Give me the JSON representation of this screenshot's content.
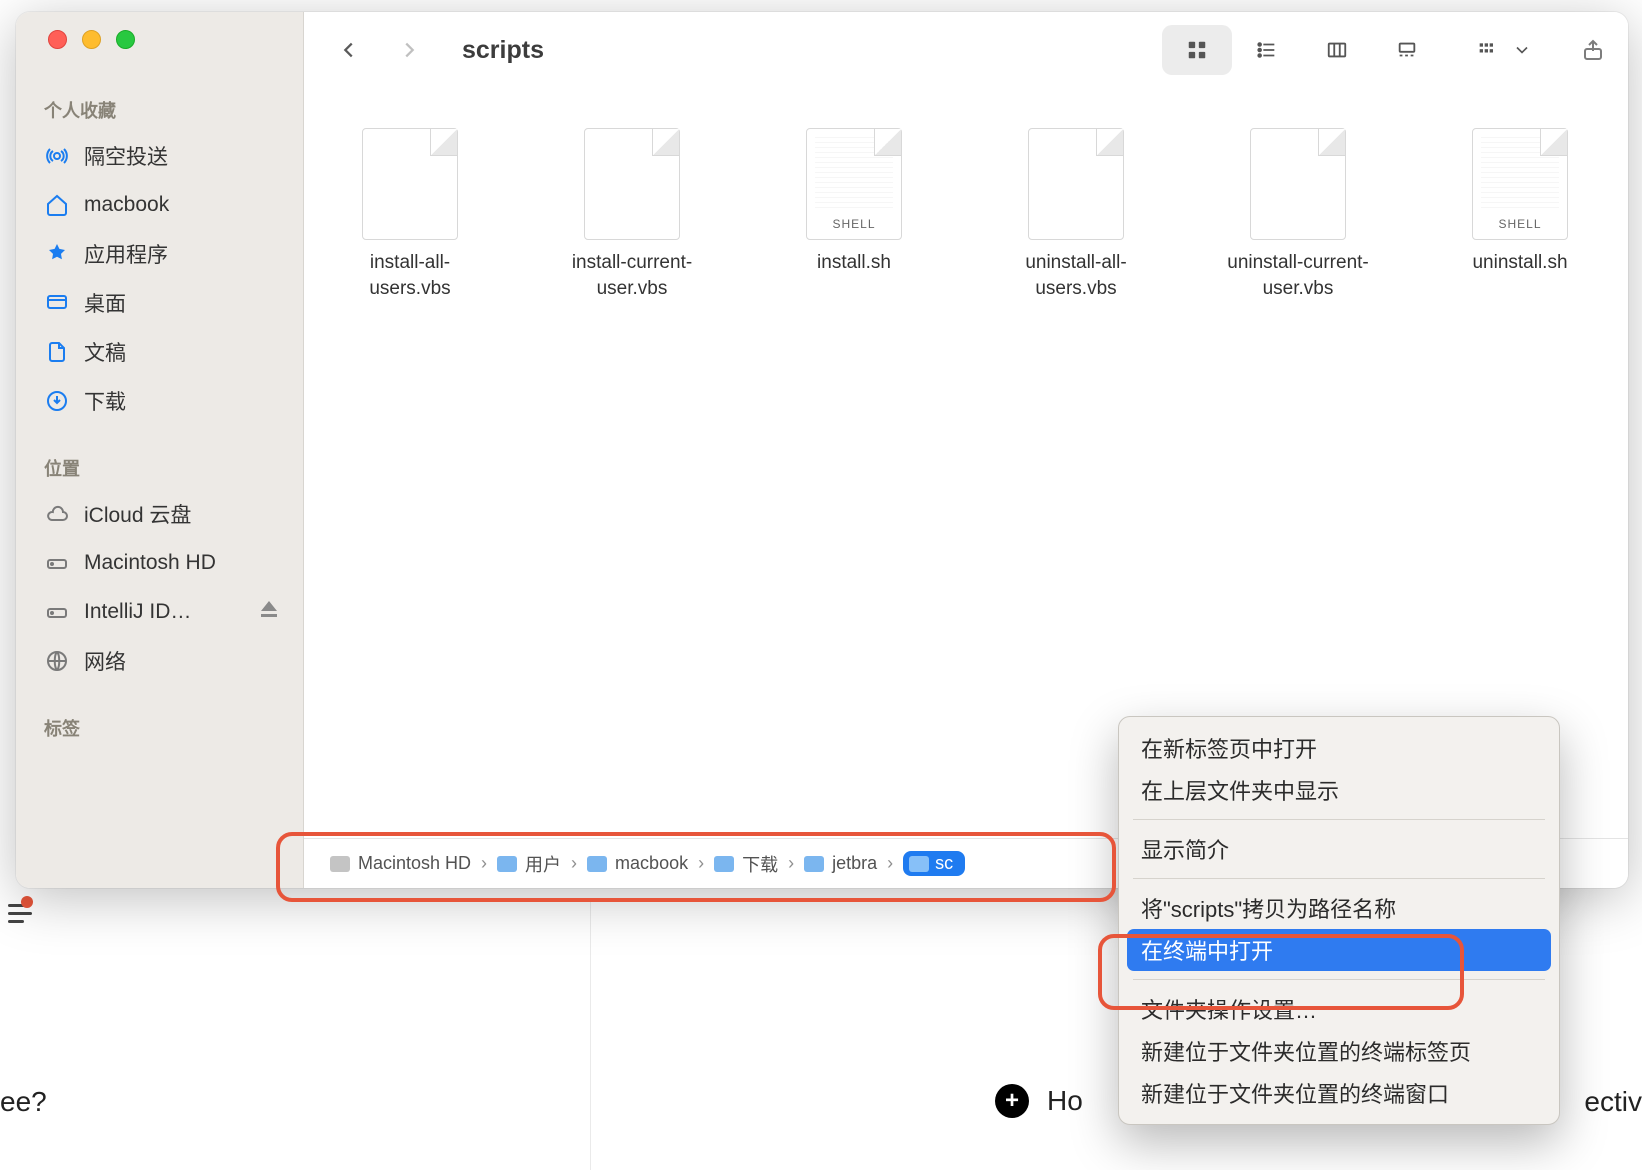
{
  "window": {
    "title": "scripts"
  },
  "sidebar": {
    "sections": [
      {
        "heading": "个人收藏",
        "items": [
          {
            "label": "隔空投送",
            "icon": "airdrop"
          },
          {
            "label": "macbook",
            "icon": "home"
          },
          {
            "label": "应用程序",
            "icon": "apps"
          },
          {
            "label": "桌面",
            "icon": "desktop"
          },
          {
            "label": "文稿",
            "icon": "documents"
          },
          {
            "label": "下载",
            "icon": "downloads"
          }
        ]
      },
      {
        "heading": "位置",
        "items": [
          {
            "label": "iCloud 云盘",
            "icon": "cloud"
          },
          {
            "label": "Macintosh HD",
            "icon": "disk"
          },
          {
            "label": "IntelliJ ID…",
            "icon": "disk",
            "eject": true
          },
          {
            "label": "网络",
            "icon": "network"
          }
        ]
      },
      {
        "heading": "标签",
        "items": []
      }
    ]
  },
  "files": [
    {
      "name": "install-all-users.vbs",
      "kind": "vbs"
    },
    {
      "name": "install-current-user.vbs",
      "kind": "vbs"
    },
    {
      "name": "install.sh",
      "kind": "shell"
    },
    {
      "name": "uninstall-all-users.vbs",
      "kind": "vbs"
    },
    {
      "name": "uninstall-current-user.vbs",
      "kind": "vbs"
    },
    {
      "name": "uninstall.sh",
      "kind": "shell"
    }
  ],
  "path": {
    "crumbs": [
      {
        "label": "Macintosh HD",
        "icon": "hd"
      },
      {
        "label": "用户",
        "icon": "folder"
      },
      {
        "label": "macbook",
        "icon": "home"
      },
      {
        "label": "下载",
        "icon": "folder"
      },
      {
        "label": "jetbra",
        "icon": "folder"
      },
      {
        "label": "sc",
        "icon": "folder",
        "selected": true
      }
    ]
  },
  "contextMenu": {
    "items": [
      {
        "label": "在新标签页中打开"
      },
      {
        "label": "在上层文件夹中显示"
      },
      {
        "sep": true
      },
      {
        "label": "显示简介"
      },
      {
        "sep": true
      },
      {
        "label": "将\"scripts\"拷贝为路径名称"
      },
      {
        "label": "在终端中打开",
        "highlight": true
      },
      {
        "sep": true
      },
      {
        "label": "文件夹操作设置…"
      },
      {
        "label": "新建位于文件夹位置的终端标签页"
      },
      {
        "label": "新建位于文件夹位置的终端窗口"
      }
    ]
  },
  "icon_labels": {
    "shell": "SHELL"
  },
  "bg": {
    "left": "ee?",
    "button": "Ho",
    "right": "ectiv"
  }
}
